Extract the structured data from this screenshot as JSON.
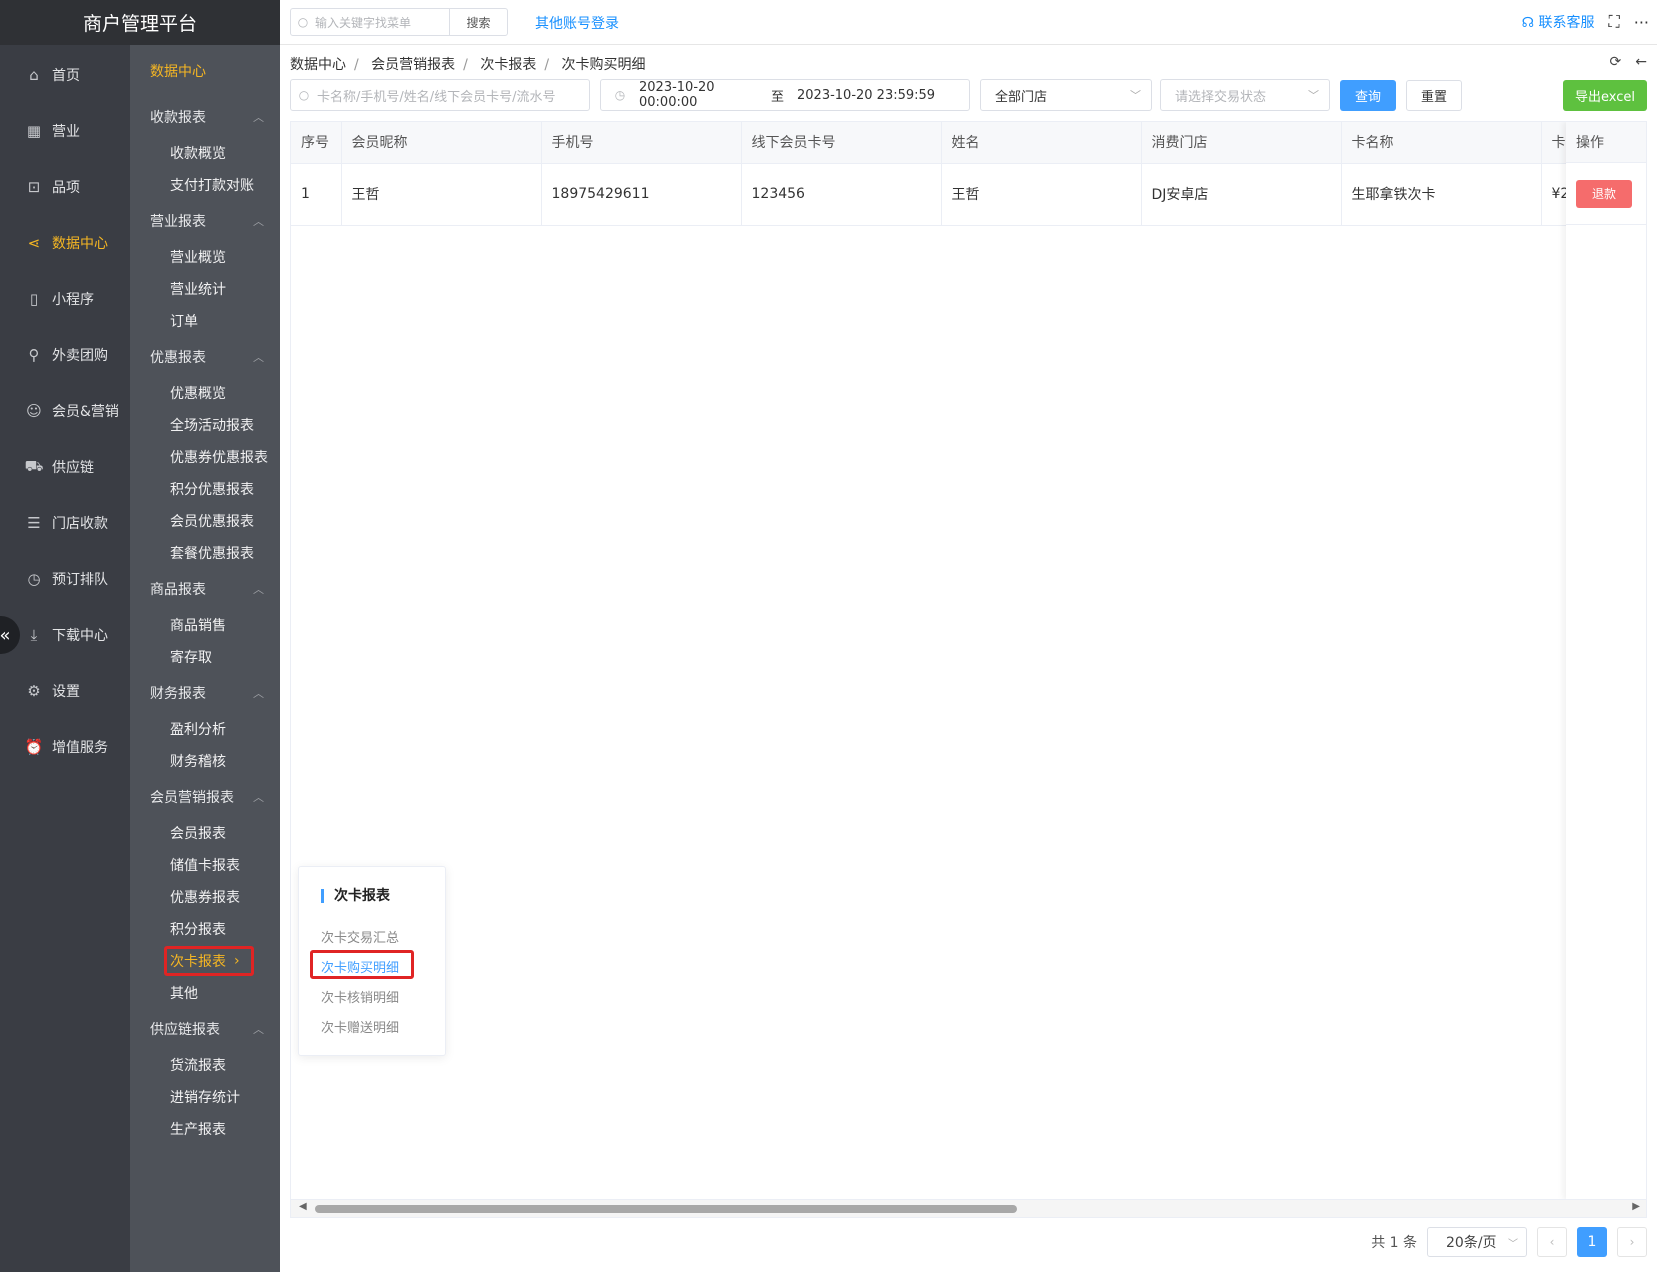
{
  "brand": "商户管理平台",
  "nav_primary": [
    {
      "label": "首页",
      "icon": "home-icon",
      "glyph": "⌂"
    },
    {
      "label": "营业",
      "icon": "calendar-icon",
      "glyph": "▦"
    },
    {
      "label": "品项",
      "icon": "bag-icon",
      "glyph": "⊡"
    },
    {
      "label": "数据中心",
      "icon": "share-icon",
      "glyph": "⋖",
      "active": true
    },
    {
      "label": "小程序",
      "icon": "phone-icon",
      "glyph": "▯"
    },
    {
      "label": "外卖团购",
      "icon": "bike-icon",
      "glyph": "⚲"
    },
    {
      "label": "会员&营销",
      "icon": "user-icon",
      "glyph": "☺"
    },
    {
      "label": "供应链",
      "icon": "truck-icon",
      "glyph": "⛟"
    },
    {
      "label": "门店收款",
      "icon": "coins-icon",
      "glyph": "☰"
    },
    {
      "label": "预订排队",
      "icon": "clock-icon",
      "glyph": "◷"
    },
    {
      "label": "下载中心",
      "icon": "download-icon",
      "glyph": "⤓"
    },
    {
      "label": "设置",
      "icon": "gear-icon",
      "glyph": "⚙"
    },
    {
      "label": "增值服务",
      "icon": "alarm-icon",
      "glyph": "⏰"
    }
  ],
  "nav_secondary": {
    "title": "数据中心",
    "groups": [
      {
        "label": "收款报表",
        "items": [
          "收款概览",
          "支付打款对账"
        ]
      },
      {
        "label": "营业报表",
        "items": [
          "营业概览",
          "营业统计",
          "订单"
        ]
      },
      {
        "label": "优惠报表",
        "items": [
          "优惠概览",
          "全场活动报表",
          "优惠券优惠报表",
          "积分优惠报表",
          "会员优惠报表",
          "套餐优惠报表"
        ]
      },
      {
        "label": "商品报表",
        "items": [
          "商品销售",
          "寄存取"
        ]
      },
      {
        "label": "财务报表",
        "items": [
          "盈利分析",
          "财务稽核"
        ]
      },
      {
        "label": "会员营销报表",
        "items": [
          "会员报表",
          "储值卡报表",
          "优惠券报表",
          "积分报表",
          "次卡报表",
          "其他"
        ]
      },
      {
        "label": "供应链报表",
        "items": [
          "货流报表",
          "进销存统计",
          "生产报表"
        ]
      }
    ]
  },
  "topbar": {
    "search_placeholder": "输入关键字找菜单",
    "search_button": "搜索",
    "other_login": "其他账号登录",
    "service": "联系客服"
  },
  "breadcrumb": [
    "数据中心",
    "会员营销报表",
    "次卡报表",
    "次卡购买明细"
  ],
  "filters": {
    "keyword_placeholder": "卡名称/手机号/姓名/线下会员卡号/流水号",
    "date_start": "2023-10-20 00:00:00",
    "date_sep": "至",
    "date_end": "2023-10-20 23:59:59",
    "store": "全部门店",
    "status_placeholder": "请选择交易状态",
    "query": "查询",
    "reset": "重置",
    "export": "导出excel"
  },
  "table": {
    "columns": [
      "序号",
      "会员昵称",
      "手机号",
      "线下会员卡号",
      "姓名",
      "消费门店",
      "卡名称",
      "卡"
    ],
    "op_column": "操作",
    "rows": [
      {
        "cells": [
          "1",
          "王哲",
          "18975429611",
          "123456",
          "王哲",
          "DJ安卓店",
          "生耶拿铁次卡",
          "¥2"
        ],
        "action": "退款"
      }
    ]
  },
  "popover": {
    "title": "次卡报表",
    "items": [
      "次卡交易汇总",
      "次卡购买明细",
      "次卡核销明细",
      "次卡赠送明细"
    ]
  },
  "pagination": {
    "total": "共 1 条",
    "page_size": "20条/页",
    "current": "1"
  }
}
